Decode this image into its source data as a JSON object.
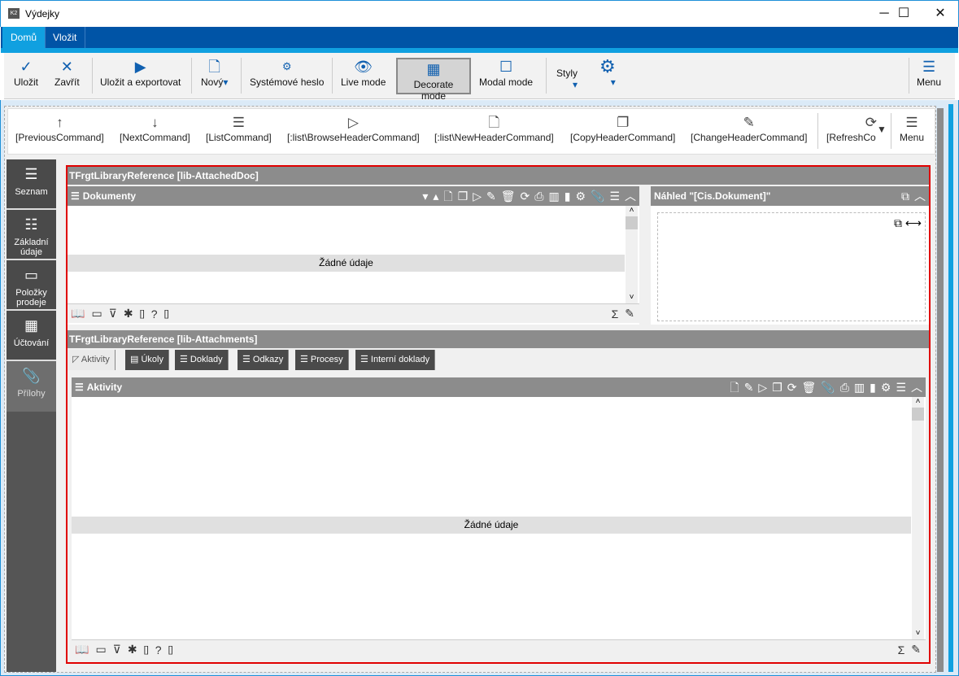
{
  "window": {
    "title": "Výdejky",
    "minimize": "─",
    "maximize": "☐",
    "close": "✕"
  },
  "ribbon_tabs": [
    {
      "label": "Domů",
      "active": true
    },
    {
      "label": "Vložit",
      "active": false
    }
  ],
  "ribbon": {
    "save": "Uložit",
    "close": "Zavřít",
    "save_export": "Uložit a exportovat",
    "new": "Nový",
    "system_password": "Systémové heslo",
    "live_mode": "Live mode",
    "decorate_mode": "Decorate mode",
    "modal_mode": "Modal mode",
    "styles": "Styly",
    "menu": "Menu"
  },
  "commands": [
    "[PreviousCommand]",
    "[NextCommand]",
    "[ListCommand]",
    "[:list\\BrowseHeaderCommand]",
    "[:list\\NewHeaderCommand]",
    "[CopyHeaderCommand]",
    "[ChangeHeaderCommand]",
    "[RefreshCo"
  ],
  "commands_menu": "Menu",
  "sidebar": [
    {
      "label": "Seznam",
      "icon": "list-icon"
    },
    {
      "label": "Základní údaje",
      "icon": "bullet-list-icon"
    },
    {
      "label": "Položky prodeje",
      "icon": "box-icon"
    },
    {
      "label": "Účtování",
      "icon": "calculator-icon"
    },
    {
      "label": "Přílohy",
      "icon": "paperclip-icon",
      "active": true
    }
  ],
  "section1": {
    "title": "TFrgtLibraryReference [lib-AttachedDoc]",
    "panel_title": "Dokumenty",
    "empty": "Žádné údaje",
    "preview_title": "Náhled \"[Cis.Dokument]\""
  },
  "section2": {
    "title": "TFrgtLibraryReference [lib-Attachments]",
    "tabs": [
      "Aktivity",
      "Úkoly",
      "Doklady",
      "Odkazy",
      "Procesy",
      "Interní doklady"
    ],
    "panel_title": "Aktivity",
    "empty": "Žádné údaje"
  },
  "footer_glyphs": {
    "brackets": "[]",
    "help": "?",
    "sum": "Σ"
  },
  "colors": {
    "accent": "#0054a6",
    "highlight": "#10a0e0",
    "decorate_border": "#e00000"
  }
}
